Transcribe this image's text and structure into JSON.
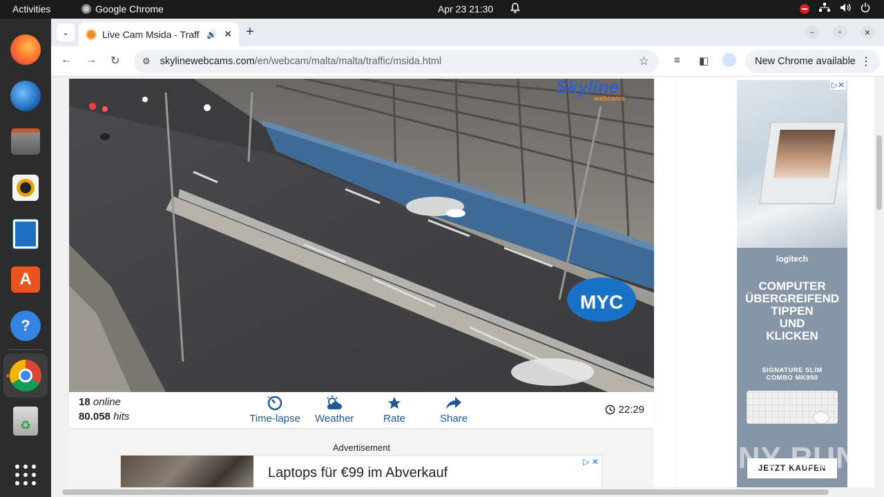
{
  "topbar": {
    "activities": "Activities",
    "app_name": "Google Chrome",
    "clock": "Apr 23  21:30"
  },
  "browser": {
    "tab_title": "Live Cam Msida - Traffi",
    "url_host": "skylinewebcams.com",
    "url_path": "/en/webcam/malta/malta/traffic/msida.html",
    "update_label": "New Chrome available"
  },
  "webcam": {
    "brand_logo": "Skyline",
    "brand_sub": "webcams",
    "overlay_logo": "MYC"
  },
  "stats": {
    "online_count": "18",
    "online_label": "online",
    "hits_count": "80.058",
    "hits_label": "hits",
    "time": "22:29"
  },
  "actions": [
    {
      "label": "Time-lapse",
      "icon": "timelapse-icon"
    },
    {
      "label": "Weather",
      "icon": "weather-icon"
    },
    {
      "label": "Rate",
      "icon": "star-icon"
    },
    {
      "label": "Share",
      "icon": "share-icon"
    }
  ],
  "ad_bottom": {
    "label": "Advertisement",
    "headline": "Laptops für €99 im Abverkauf"
  },
  "ad_side": {
    "brand": "logitech",
    "headline_lines": [
      "COMPUTER",
      "ÜBERGREIFEND",
      "TIPPEN",
      "UND",
      "KLICKEN"
    ],
    "product_lines": [
      "SIGNATURE SLIM",
      "COMBO MK950"
    ],
    "cta": "JETZT KAUFEN"
  },
  "watermark": "ANY RUN",
  "colors": {
    "accent_blue": "#1e5896",
    "ubuntu_orange": "#e95420"
  }
}
